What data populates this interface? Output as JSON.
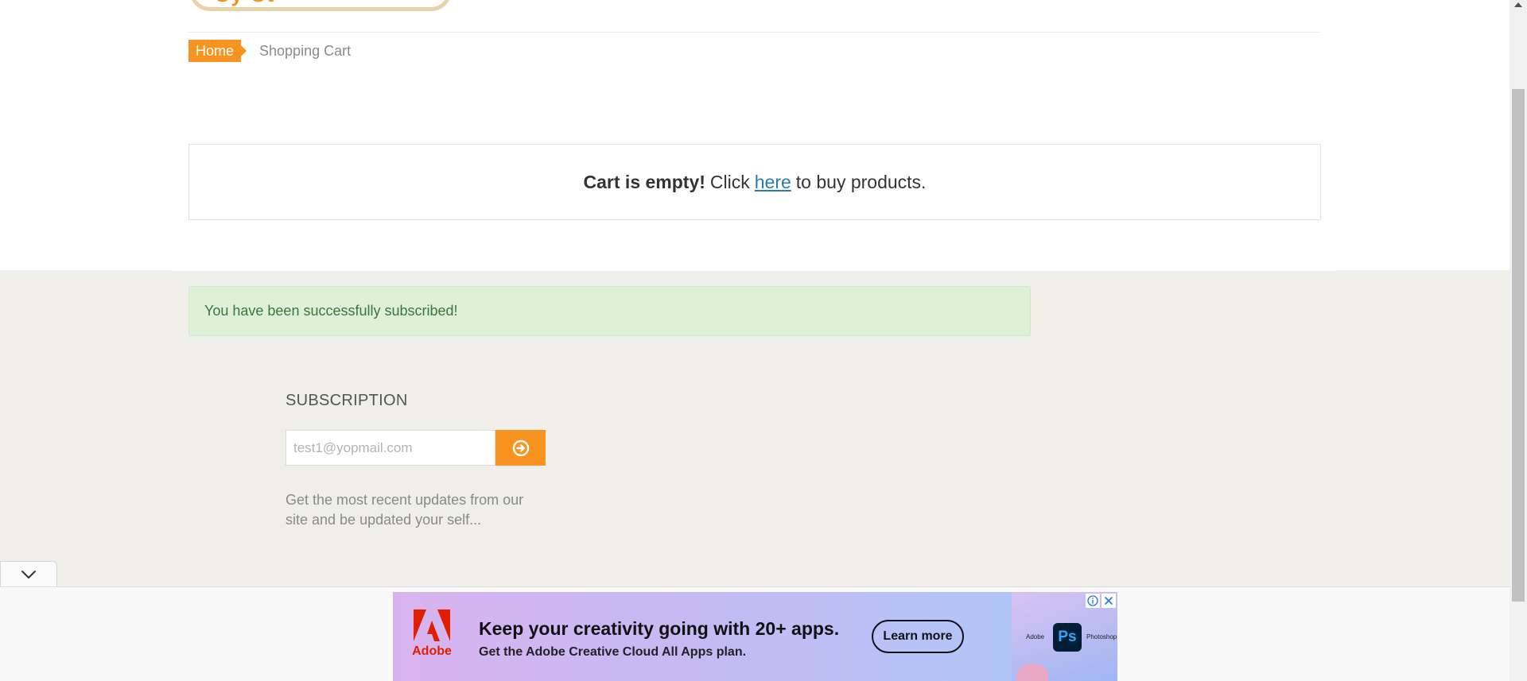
{
  "header": {
    "logo_text": "Sy   St"
  },
  "breadcrumb": {
    "home_label": "Home",
    "current_label": "Shopping Cart"
  },
  "cart": {
    "empty_strong": "Cart is empty!",
    "click_text": "Click",
    "link_text": "here",
    "tail_text": "to buy products."
  },
  "footer": {
    "alert_text": "You have been successfully subscribed!",
    "subscription_heading": "SUBSCRIPTION",
    "email_placeholder": "test1@yopmail.com",
    "email_value": "",
    "description": "Get the most recent updates from our site and be updated your self..."
  },
  "ad": {
    "brand": "Adobe",
    "headline": "Keep your creativity going with 20+ apps.",
    "subline": "Get the Adobe Creative Cloud All Apps plan.",
    "cta": "Learn more",
    "tile_left_label": "Adobe",
    "tile_text": "Ps",
    "tile_right_label": "Photoshop"
  },
  "colors": {
    "accent": "#f7931e",
    "link": "#2a7ab0",
    "success_bg": "#dff0d8",
    "success_text": "#3c763d",
    "footer_bg": "#efeee8"
  },
  "icons": {
    "subscribe": "circle-arrow-right-icon",
    "collapse": "chevron-down-icon",
    "ad_info": "info-icon",
    "ad_close": "close-icon"
  }
}
